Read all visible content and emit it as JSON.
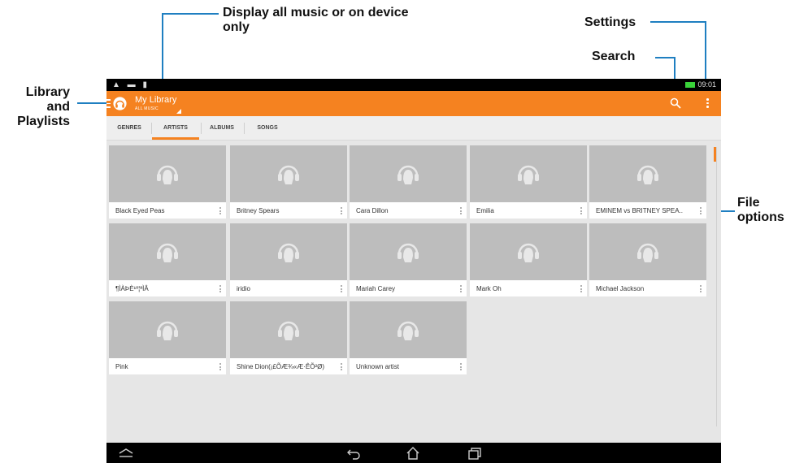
{
  "callouts": {
    "display_all": "Display all music or on device only",
    "settings": "Settings",
    "search": "Search",
    "library": "Library and Playlists",
    "file_options": "File options"
  },
  "colors": {
    "accent": "#f58220",
    "callout_line": "#1f7fc1",
    "status_bar": "#000000"
  },
  "status_bar": {
    "time": "09:01"
  },
  "action_bar": {
    "title": "My Library",
    "subtitle": "ALL MUSIC",
    "icons": [
      "menu-lines-icon",
      "headphones-icon",
      "dropdown-triangle-icon",
      "search-icon",
      "overflow-menu-icon"
    ]
  },
  "tabs": [
    {
      "label": "GENRES",
      "active": false
    },
    {
      "label": "ARTISTS",
      "active": true
    },
    {
      "label": "ALBUMS",
      "active": false
    },
    {
      "label": "SONGS",
      "active": false
    }
  ],
  "artists": [
    "Black Eyed Peas",
    "Britney Spears",
    "Cara Dillon",
    "Emilia",
    "EMINEM vs BRITNEY SPEA..",
    "¶ÌÀÞÈ¹º¦ªÌÂ",
    "iridio",
    "Mariah Carey",
    "Mark Oh",
    "Michael Jackson",
    "Pink",
    "Shine Dion(¡£ÕÆ¾«Æ·ÊÕ²Ø)",
    "Unknown artist"
  ],
  "nav_bar": {
    "icons": [
      "collapse-icon",
      "back-icon",
      "home-icon",
      "recent-apps-icon"
    ]
  }
}
